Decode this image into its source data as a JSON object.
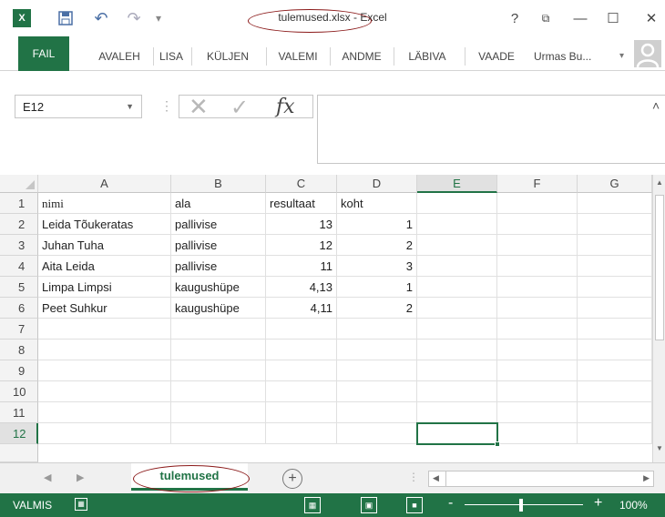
{
  "window": {
    "title": "tulemused.xlsx - Excel",
    "app_icon": "excel-icon",
    "help": "?",
    "restore": "⧉",
    "minimize": "—",
    "maximize": "☐",
    "close": "✕"
  },
  "qat": {
    "save": "💾",
    "undo": "↶",
    "redo": "↷",
    "more": "▾"
  },
  "ribbon": {
    "tabs": [
      "FAIL",
      "AVALEH",
      "LISA",
      "KÜLJEN",
      "VALEMI",
      "ANDME",
      "LÄBIVA",
      "VAADE"
    ],
    "user": "Urmas Bu...",
    "user_caret": "▾"
  },
  "formula": {
    "name_box": "E12",
    "cancel": "✕",
    "enter": "✓",
    "fx": "fx",
    "value": "",
    "collapse": "˄"
  },
  "grid": {
    "columns": [
      "A",
      "B",
      "C",
      "D",
      "E",
      "F",
      "G"
    ],
    "selected_column": "E",
    "rows": [
      "1",
      "2",
      "3",
      "4",
      "5",
      "6",
      "7",
      "8",
      "9",
      "10",
      "11",
      "12"
    ],
    "selected_row": "12",
    "cells": [
      [
        "nimi",
        "ala",
        "resultaat",
        "koht"
      ],
      [
        "Leida Tõukeratas",
        "pallivise",
        "13",
        "1"
      ],
      [
        "Juhan Tuha",
        "pallivise",
        "12",
        "2"
      ],
      [
        "Aita Leida",
        "pallivise",
        "11",
        "3"
      ],
      [
        "Limpa Limpsi",
        "kaugushüpe",
        "4,13",
        "1"
      ],
      [
        "Peet Suhkur",
        "kaugushüpe",
        "4,11",
        "2"
      ]
    ],
    "active_cell": "E12"
  },
  "sheets": {
    "tabs": [
      "tulemused"
    ],
    "active": "tulemused",
    "add": "+",
    "nav_prev": "◀",
    "nav_next": "▶"
  },
  "status": {
    "text": "VALMIS",
    "zoom": "100%",
    "zoom_minus": "-",
    "zoom_plus": "+"
  },
  "colors": {
    "excel_green": "#217346",
    "annotation": "#8b1a1a"
  }
}
